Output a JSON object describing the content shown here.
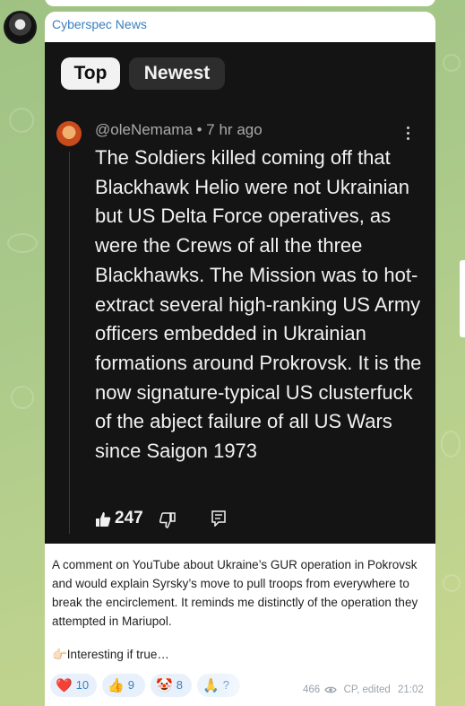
{
  "channel": {
    "name": "Cyberspec News"
  },
  "youtube_comment": {
    "tabs": [
      "Top",
      "Newest"
    ],
    "meta": "@oleNemama • 7 hr ago",
    "text": "The Soldiers killed coming off that Blackhawk Helio were not Ukrainian but US Delta Force operatives, as were the Crews of all the three Blackhawks. The Mission was to hot-extract several high-ranking US Army officers embedded in Ukrainian formations around Prokrovsk. It is the now signature-typical US clusterfuck of the abject failure of all US Wars since Saigon 1973",
    "likes": "247"
  },
  "post": {
    "caption": "A comment on YouTube about Ukraine’s GUR operation in Pokrovsk and would explain Syrsky’s move to pull troops from everywhere to break the encirclement. It reminds me distinctly of the operation they attempted in Mariupol.",
    "note": "👉🏻Interesting if true…"
  },
  "reactions": [
    {
      "emoji": "❤️",
      "count": "10"
    },
    {
      "emoji": "👍",
      "count": "9"
    },
    {
      "emoji": "🤡",
      "count": "8"
    },
    {
      "emoji": "🙏",
      "count": "?"
    }
  ],
  "footer": {
    "views": "466",
    "author": "CP, edited",
    "time": "21:02"
  },
  "colors": {
    "link": "#3a7fc0",
    "comment_bg": "#141414",
    "reaction_bg": "#e8f1fb"
  },
  "icons": [
    "avatar",
    "like-icon",
    "dislike-icon",
    "reply-icon",
    "eye-icon",
    "more-icon"
  ]
}
